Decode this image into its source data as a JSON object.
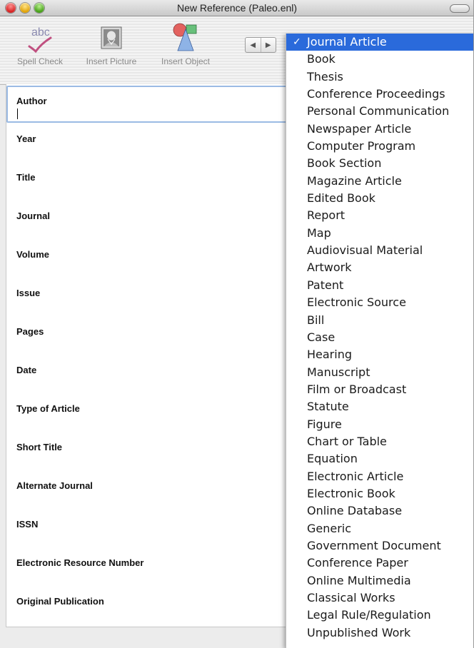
{
  "window": {
    "title": "New Reference (Paleo.enl)"
  },
  "toolbar": {
    "spell_check": "Spell Check",
    "insert_picture": "Insert Picture",
    "insert_object": "Insert Object",
    "spell_icon_text": "abc"
  },
  "form": {
    "fields": [
      "Author",
      "Year",
      "Title",
      "Journal",
      "Volume",
      "Issue",
      "Pages",
      "Date",
      "Type of Article",
      "Short Title",
      "Alternate Journal",
      "ISSN",
      "Electronic Resource Number",
      "Original Publication"
    ]
  },
  "menu": {
    "check": "✓",
    "selected_index": 0,
    "items": [
      "Journal Article",
      "Book",
      "Thesis",
      "Conference Proceedings",
      "Personal Communication",
      "Newspaper Article",
      "Computer Program",
      "Book Section",
      "Magazine Article",
      "Edited Book",
      "Report",
      "Map",
      "Audiovisual Material",
      "Artwork",
      "Patent",
      "Electronic Source",
      "Bill",
      "Case",
      "Hearing",
      "Manuscript",
      "Film or Broadcast",
      "Statute",
      "Figure",
      "Chart or Table",
      "Equation",
      "Electronic Article",
      "Electronic Book",
      "Online Database",
      "Generic",
      "Government Document",
      "Conference Paper",
      "Online Multimedia",
      "Classical Works",
      "Legal Rule/Regulation",
      "Unpublished Work"
    ]
  },
  "colors": {
    "selection": "#2a6adb",
    "focus_ring": "#9bbbe4"
  }
}
